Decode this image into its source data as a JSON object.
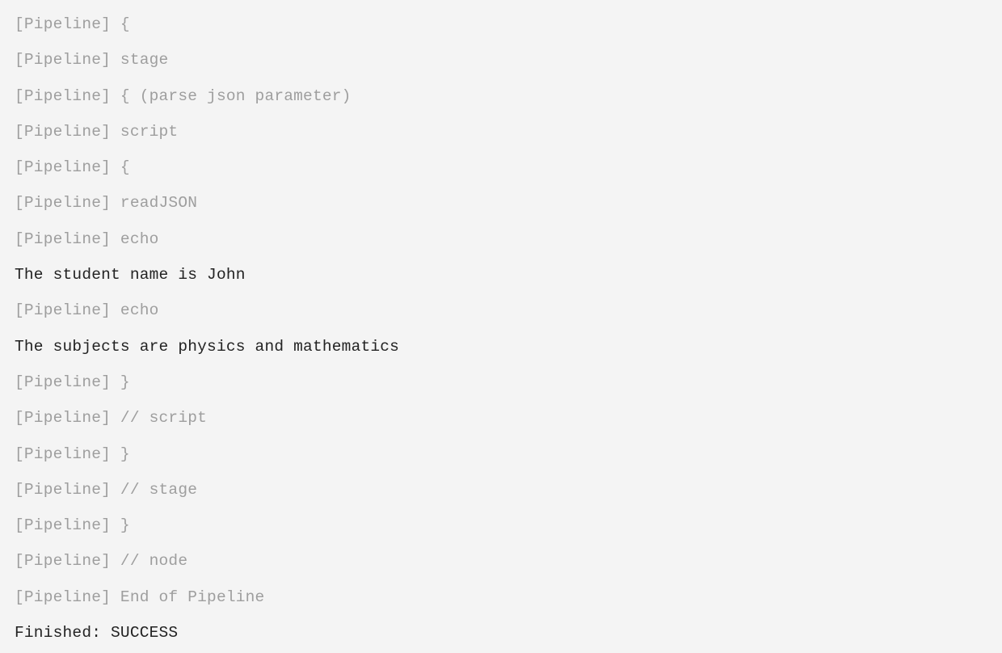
{
  "console": {
    "lines": [
      {
        "cls": "pipeline",
        "text": "[Pipeline] {"
      },
      {
        "cls": "pipeline",
        "text": "[Pipeline] stage"
      },
      {
        "cls": "pipeline",
        "text": "[Pipeline] { (parse json parameter)"
      },
      {
        "cls": "pipeline",
        "text": "[Pipeline] script"
      },
      {
        "cls": "pipeline",
        "text": "[Pipeline] {"
      },
      {
        "cls": "pipeline",
        "text": "[Pipeline] readJSON"
      },
      {
        "cls": "pipeline",
        "text": "[Pipeline] echo"
      },
      {
        "cls": "output",
        "text": "The student name is John"
      },
      {
        "cls": "pipeline",
        "text": "[Pipeline] echo"
      },
      {
        "cls": "output",
        "text": "The subjects are physics and mathematics"
      },
      {
        "cls": "pipeline",
        "text": "[Pipeline] }"
      },
      {
        "cls": "pipeline",
        "text": "[Pipeline] // script"
      },
      {
        "cls": "pipeline",
        "text": "[Pipeline] }"
      },
      {
        "cls": "pipeline",
        "text": "[Pipeline] // stage"
      },
      {
        "cls": "pipeline",
        "text": "[Pipeline] }"
      },
      {
        "cls": "pipeline",
        "text": "[Pipeline] // node"
      },
      {
        "cls": "pipeline",
        "text": "[Pipeline] End of Pipeline"
      },
      {
        "cls": "output",
        "text": "Finished: SUCCESS"
      }
    ]
  }
}
